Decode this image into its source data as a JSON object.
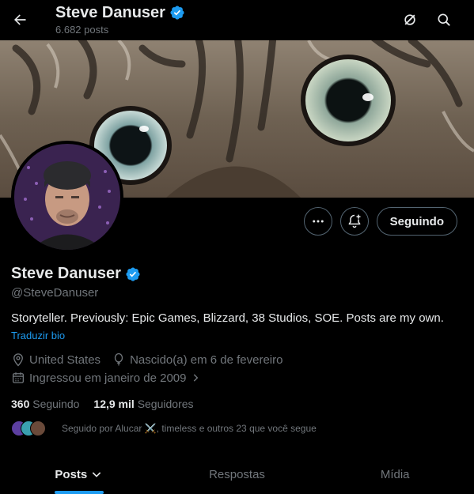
{
  "header": {
    "name": "Steve Danuser",
    "posts_count": "6.682 posts"
  },
  "profile": {
    "name": "Steve Danuser",
    "handle": "@SteveDanuser",
    "bio": "Storyteller. Previously: Epic Games, Blizzard, 38 Studios, SOE. Posts are my own.",
    "translate_label": "Traduzir bio",
    "location": "United States",
    "birthday": "Nascido(a) em 6 de fevereiro",
    "joined": "Ingressou em janeiro de 2009",
    "following_count": "360",
    "following_label": "Seguindo",
    "followers_count": "12,9 mil",
    "followers_label": "Seguidores",
    "followed_by_text": "Seguido por Alucar ⚔️, timeless e outros 23 que você segue"
  },
  "actions": {
    "follow_button_label": "Seguindo"
  },
  "tabs": [
    {
      "label": "Posts",
      "active": true
    },
    {
      "label": "Respostas",
      "active": false
    },
    {
      "label": "Mídia",
      "active": false
    }
  ],
  "colors": {
    "accent": "#1d9bf0",
    "background": "#000000",
    "muted_text": "#71767b"
  },
  "icons": [
    "back-arrow-icon",
    "verified-badge-icon",
    "grok-icon",
    "search-icon",
    "more-icon",
    "notification-plus-icon",
    "location-icon",
    "balloon-icon",
    "calendar-icon",
    "chevron-right-icon",
    "chevron-down-icon"
  ]
}
